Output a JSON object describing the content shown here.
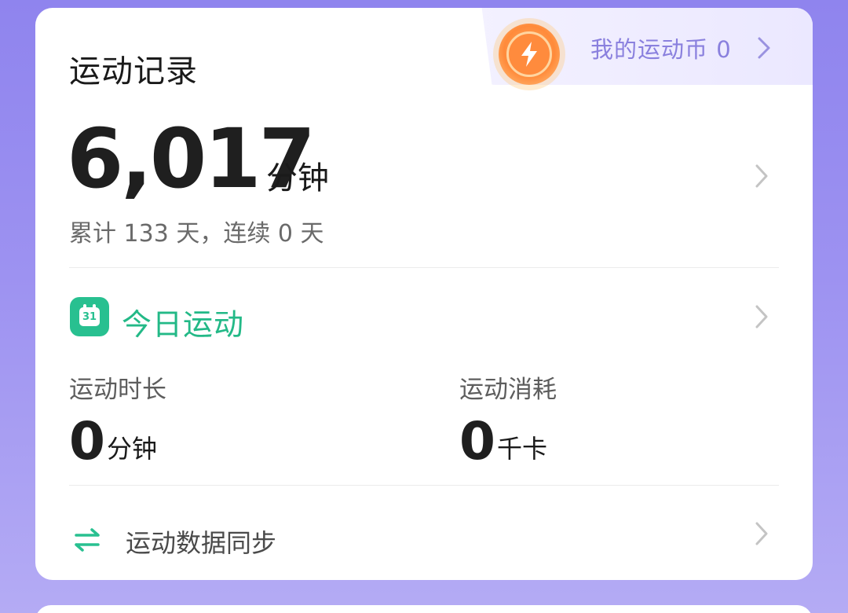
{
  "record": {
    "title": "运动记录",
    "coin_label": "我的运动币 0",
    "total_value": "6,017",
    "total_unit": "分钟",
    "streak_text": "累计 133 天，连续 0 天"
  },
  "today": {
    "calendar_day": "31",
    "title": "今日运动",
    "duration_label": "运动时长",
    "duration_value": "0",
    "duration_unit": "分钟",
    "calories_label": "运动消耗",
    "calories_value": "0",
    "calories_unit": "千卡"
  },
  "sync": {
    "label": "运动数据同步"
  },
  "colors": {
    "accent_green": "#23b987",
    "accent_purple": "#8a80de",
    "coin_orange": "#ff8b3d",
    "background_purple": "#9d92f1"
  },
  "icons": {
    "coin": "lightning-coin-icon",
    "calendar": "calendar-icon",
    "sync": "sync-arrows-icon",
    "chevron": "chevron-right-icon"
  }
}
